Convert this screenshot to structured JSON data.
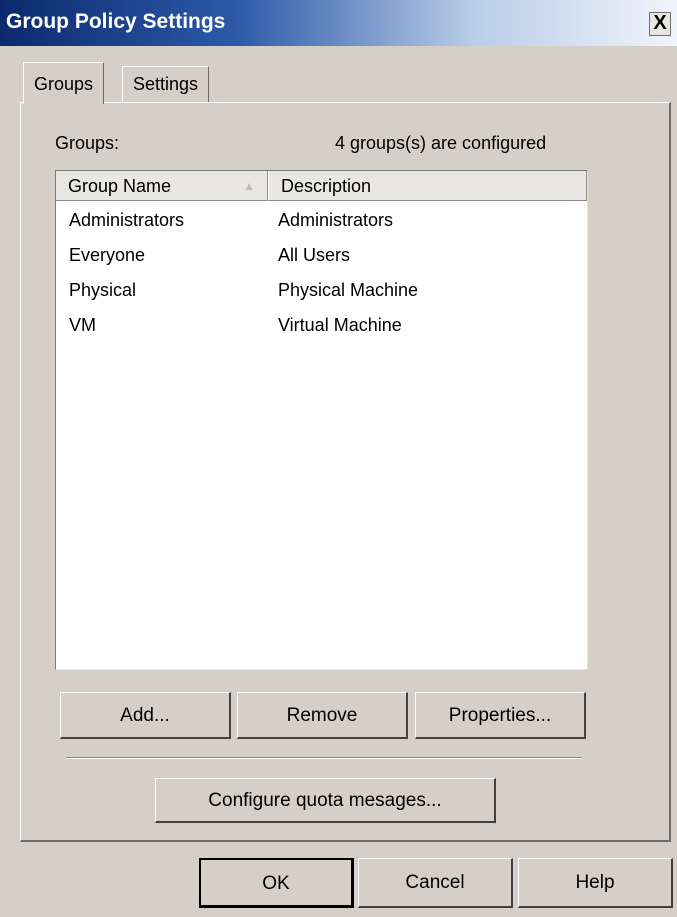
{
  "window": {
    "title": "Group Policy Settings",
    "close_label": "X"
  },
  "tabs": [
    {
      "label": "Groups"
    },
    {
      "label": "Settings"
    }
  ],
  "groups_panel": {
    "groups_label": "Groups:",
    "count_label": "4 groups(s) are configured",
    "columns": [
      "Group Name",
      "Description"
    ],
    "sort_indicator": "▲",
    "rows": [
      {
        "name": "Administrators",
        "description": "Administrators"
      },
      {
        "name": "Everyone",
        "description": "All Users"
      },
      {
        "name": "Physical",
        "description": "Physical Machine"
      },
      {
        "name": "VM",
        "description": "Virtual Machine"
      }
    ],
    "buttons": {
      "add": "Add...",
      "remove": "Remove",
      "properties": "Properties..."
    },
    "configure_quota": "Configure quota mesages..."
  },
  "dialog_buttons": {
    "ok": "OK",
    "cancel": "Cancel",
    "help": "Help"
  }
}
